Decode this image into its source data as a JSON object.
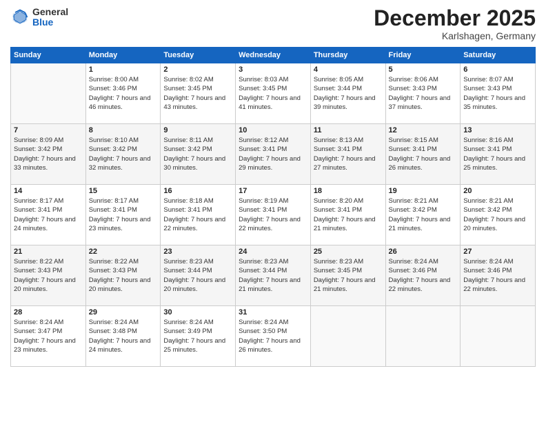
{
  "header": {
    "logo_general": "General",
    "logo_blue": "Blue",
    "month_title": "December 2025",
    "location": "Karlshagen, Germany"
  },
  "weekdays": [
    "Sunday",
    "Monday",
    "Tuesday",
    "Wednesday",
    "Thursday",
    "Friday",
    "Saturday"
  ],
  "weeks": [
    [
      {
        "day": "",
        "sunrise": "",
        "sunset": "",
        "daylight": ""
      },
      {
        "day": "1",
        "sunrise": "Sunrise: 8:00 AM",
        "sunset": "Sunset: 3:46 PM",
        "daylight": "Daylight: 7 hours and 46 minutes."
      },
      {
        "day": "2",
        "sunrise": "Sunrise: 8:02 AM",
        "sunset": "Sunset: 3:45 PM",
        "daylight": "Daylight: 7 hours and 43 minutes."
      },
      {
        "day": "3",
        "sunrise": "Sunrise: 8:03 AM",
        "sunset": "Sunset: 3:45 PM",
        "daylight": "Daylight: 7 hours and 41 minutes."
      },
      {
        "day": "4",
        "sunrise": "Sunrise: 8:05 AM",
        "sunset": "Sunset: 3:44 PM",
        "daylight": "Daylight: 7 hours and 39 minutes."
      },
      {
        "day": "5",
        "sunrise": "Sunrise: 8:06 AM",
        "sunset": "Sunset: 3:43 PM",
        "daylight": "Daylight: 7 hours and 37 minutes."
      },
      {
        "day": "6",
        "sunrise": "Sunrise: 8:07 AM",
        "sunset": "Sunset: 3:43 PM",
        "daylight": "Daylight: 7 hours and 35 minutes."
      }
    ],
    [
      {
        "day": "7",
        "sunrise": "Sunrise: 8:09 AM",
        "sunset": "Sunset: 3:42 PM",
        "daylight": "Daylight: 7 hours and 33 minutes."
      },
      {
        "day": "8",
        "sunrise": "Sunrise: 8:10 AM",
        "sunset": "Sunset: 3:42 PM",
        "daylight": "Daylight: 7 hours and 32 minutes."
      },
      {
        "day": "9",
        "sunrise": "Sunrise: 8:11 AM",
        "sunset": "Sunset: 3:42 PM",
        "daylight": "Daylight: 7 hours and 30 minutes."
      },
      {
        "day": "10",
        "sunrise": "Sunrise: 8:12 AM",
        "sunset": "Sunset: 3:41 PM",
        "daylight": "Daylight: 7 hours and 29 minutes."
      },
      {
        "day": "11",
        "sunrise": "Sunrise: 8:13 AM",
        "sunset": "Sunset: 3:41 PM",
        "daylight": "Daylight: 7 hours and 27 minutes."
      },
      {
        "day": "12",
        "sunrise": "Sunrise: 8:15 AM",
        "sunset": "Sunset: 3:41 PM",
        "daylight": "Daylight: 7 hours and 26 minutes."
      },
      {
        "day": "13",
        "sunrise": "Sunrise: 8:16 AM",
        "sunset": "Sunset: 3:41 PM",
        "daylight": "Daylight: 7 hours and 25 minutes."
      }
    ],
    [
      {
        "day": "14",
        "sunrise": "Sunrise: 8:17 AM",
        "sunset": "Sunset: 3:41 PM",
        "daylight": "Daylight: 7 hours and 24 minutes."
      },
      {
        "day": "15",
        "sunrise": "Sunrise: 8:17 AM",
        "sunset": "Sunset: 3:41 PM",
        "daylight": "Daylight: 7 hours and 23 minutes."
      },
      {
        "day": "16",
        "sunrise": "Sunrise: 8:18 AM",
        "sunset": "Sunset: 3:41 PM",
        "daylight": "Daylight: 7 hours and 22 minutes."
      },
      {
        "day": "17",
        "sunrise": "Sunrise: 8:19 AM",
        "sunset": "Sunset: 3:41 PM",
        "daylight": "Daylight: 7 hours and 22 minutes."
      },
      {
        "day": "18",
        "sunrise": "Sunrise: 8:20 AM",
        "sunset": "Sunset: 3:41 PM",
        "daylight": "Daylight: 7 hours and 21 minutes."
      },
      {
        "day": "19",
        "sunrise": "Sunrise: 8:21 AM",
        "sunset": "Sunset: 3:42 PM",
        "daylight": "Daylight: 7 hours and 21 minutes."
      },
      {
        "day": "20",
        "sunrise": "Sunrise: 8:21 AM",
        "sunset": "Sunset: 3:42 PM",
        "daylight": "Daylight: 7 hours and 20 minutes."
      }
    ],
    [
      {
        "day": "21",
        "sunrise": "Sunrise: 8:22 AM",
        "sunset": "Sunset: 3:43 PM",
        "daylight": "Daylight: 7 hours and 20 minutes."
      },
      {
        "day": "22",
        "sunrise": "Sunrise: 8:22 AM",
        "sunset": "Sunset: 3:43 PM",
        "daylight": "Daylight: 7 hours and 20 minutes."
      },
      {
        "day": "23",
        "sunrise": "Sunrise: 8:23 AM",
        "sunset": "Sunset: 3:44 PM",
        "daylight": "Daylight: 7 hours and 20 minutes."
      },
      {
        "day": "24",
        "sunrise": "Sunrise: 8:23 AM",
        "sunset": "Sunset: 3:44 PM",
        "daylight": "Daylight: 7 hours and 21 minutes."
      },
      {
        "day": "25",
        "sunrise": "Sunrise: 8:23 AM",
        "sunset": "Sunset: 3:45 PM",
        "daylight": "Daylight: 7 hours and 21 minutes."
      },
      {
        "day": "26",
        "sunrise": "Sunrise: 8:24 AM",
        "sunset": "Sunset: 3:46 PM",
        "daylight": "Daylight: 7 hours and 22 minutes."
      },
      {
        "day": "27",
        "sunrise": "Sunrise: 8:24 AM",
        "sunset": "Sunset: 3:46 PM",
        "daylight": "Daylight: 7 hours and 22 minutes."
      }
    ],
    [
      {
        "day": "28",
        "sunrise": "Sunrise: 8:24 AM",
        "sunset": "Sunset: 3:47 PM",
        "daylight": "Daylight: 7 hours and 23 minutes."
      },
      {
        "day": "29",
        "sunrise": "Sunrise: 8:24 AM",
        "sunset": "Sunset: 3:48 PM",
        "daylight": "Daylight: 7 hours and 24 minutes."
      },
      {
        "day": "30",
        "sunrise": "Sunrise: 8:24 AM",
        "sunset": "Sunset: 3:49 PM",
        "daylight": "Daylight: 7 hours and 25 minutes."
      },
      {
        "day": "31",
        "sunrise": "Sunrise: 8:24 AM",
        "sunset": "Sunset: 3:50 PM",
        "daylight": "Daylight: 7 hours and 26 minutes."
      },
      {
        "day": "",
        "sunrise": "",
        "sunset": "",
        "daylight": ""
      },
      {
        "day": "",
        "sunrise": "",
        "sunset": "",
        "daylight": ""
      },
      {
        "day": "",
        "sunrise": "",
        "sunset": "",
        "daylight": ""
      }
    ]
  ]
}
